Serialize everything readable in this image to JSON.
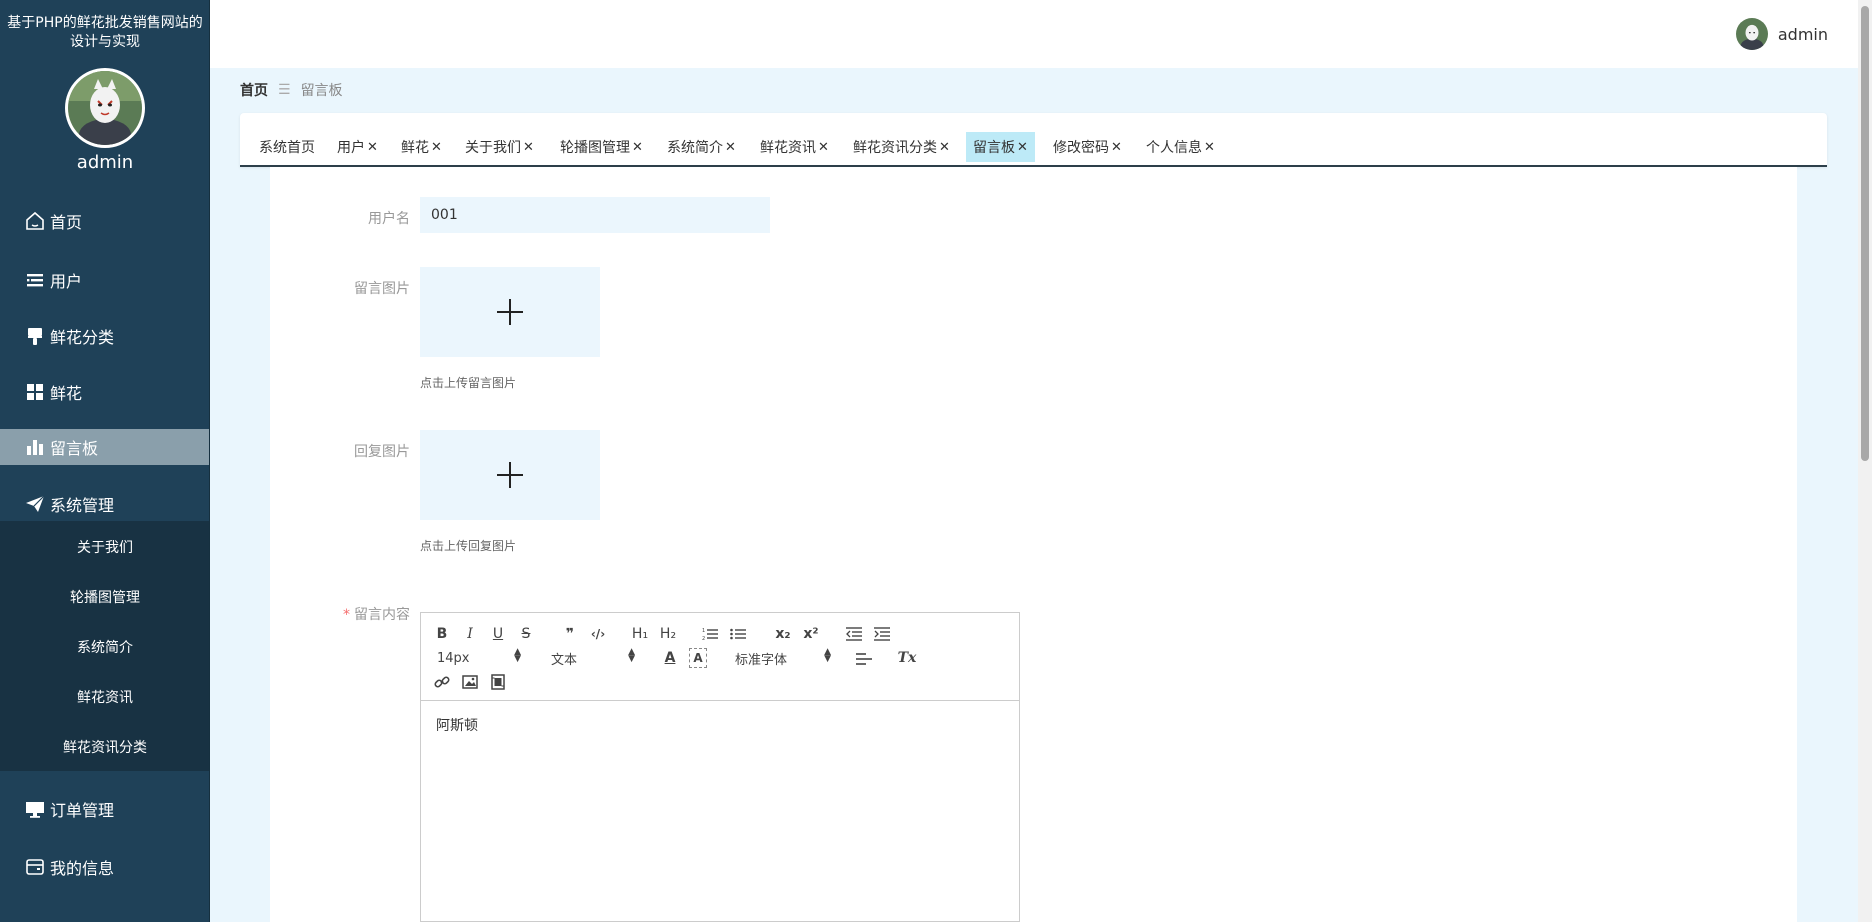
{
  "sidebar": {
    "site_title": "基于PHP的鲜花批发销售网站的设计与实现",
    "username": "admin",
    "menu": [
      {
        "label": "首页",
        "icon": "home-icon"
      },
      {
        "label": "用户",
        "icon": "list-icon"
      },
      {
        "label": "鲜花分类",
        "icon": "brush-icon"
      },
      {
        "label": "鲜花",
        "icon": "grid-icon"
      },
      {
        "label": "留言板",
        "icon": "bar-chart-icon",
        "active": true
      },
      {
        "label": "系统管理",
        "icon": "send-icon"
      },
      {
        "label": "订单管理",
        "icon": "monitor-icon"
      },
      {
        "label": "我的信息",
        "icon": "wallet-icon"
      }
    ],
    "submenu": [
      "关于我们",
      "轮播图管理",
      "系统简介",
      "鲜花资讯",
      "鲜花资讯分类"
    ]
  },
  "header": {
    "username": "admin"
  },
  "breadcrumb": {
    "home": "首页",
    "separator": "☰",
    "current": "留言板"
  },
  "tabs": [
    {
      "label": "系统首页",
      "closable": false
    },
    {
      "label": "用户",
      "closable": true
    },
    {
      "label": "鲜花",
      "closable": true
    },
    {
      "label": "关于我们",
      "closable": true
    },
    {
      "label": "轮播图管理",
      "closable": true
    },
    {
      "label": "系统简介",
      "closable": true
    },
    {
      "label": "鲜花资讯",
      "closable": true
    },
    {
      "label": "鲜花资讯分类",
      "closable": true
    },
    {
      "label": "留言板",
      "closable": true,
      "active": true
    },
    {
      "label": "修改密码",
      "closable": true
    },
    {
      "label": "个人信息",
      "closable": true
    }
  ],
  "tab_close_glyph": "✕",
  "form": {
    "username_label": "用户名",
    "username_value": "001",
    "message_image_label": "留言图片",
    "message_image_hint": "点击上传留言图片",
    "reply_image_label": "回复图片",
    "reply_image_hint": "点击上传回复图片",
    "content_label": "留言内容",
    "content_required_mark": "*",
    "content_value": "阿斯顿"
  },
  "editor": {
    "font_size": "14px",
    "header_select": "文本",
    "font_family": "标准字体",
    "buttons": {
      "bold": "B",
      "italic": "I",
      "underline": "U",
      "strike": "S",
      "quote": "❞",
      "code": "‹/›",
      "h1": "H₁",
      "h2": "H₂",
      "sub": "x₂",
      "sup": "x²",
      "clean": "Tx",
      "color": "A",
      "bg": "A"
    }
  },
  "colors": {
    "sidebar_bg": "#1f4158",
    "sidebar_active": "#8a9fab",
    "page_bg": "#eaf6fd",
    "active_tab": "#bdeaf7",
    "required": "#f56c6c"
  }
}
